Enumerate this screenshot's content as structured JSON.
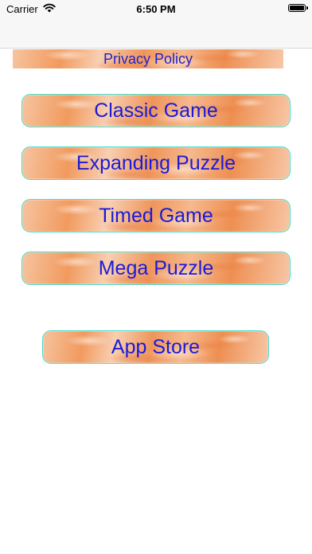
{
  "status_bar": {
    "carrier": "Carrier",
    "time": "6:50 PM",
    "wifi_icon": "wifi-icon",
    "battery_icon": "battery-icon"
  },
  "privacy": {
    "label": "Privacy Policy"
  },
  "menu": {
    "classic_label": "Classic Game",
    "expanding_label": "Expanding Puzzle",
    "timed_label": "Timed Game",
    "mega_label": "Mega Puzzle",
    "appstore_label": "App Store"
  },
  "colors": {
    "button_text": "#1b1bd6",
    "button_border": "#48dcc8",
    "button_fill": "#f3a672"
  }
}
